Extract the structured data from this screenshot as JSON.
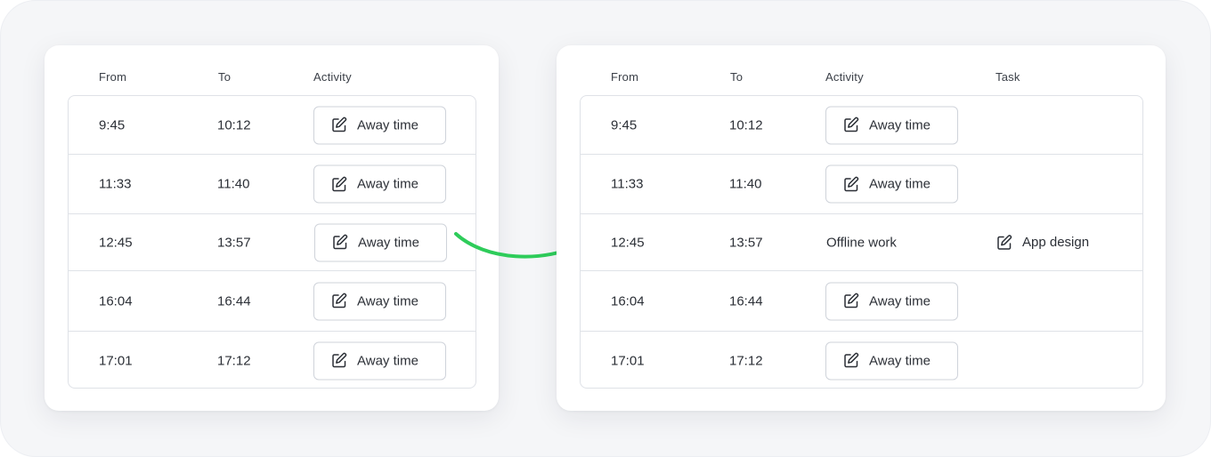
{
  "left_table": {
    "headers": {
      "from": "From",
      "to": "To",
      "activity": "Activity"
    },
    "rows": [
      {
        "from": "9:45",
        "to": "10:12",
        "activity": "Away time"
      },
      {
        "from": "11:33",
        "to": "11:40",
        "activity": "Away time"
      },
      {
        "from": "12:45",
        "to": "13:57",
        "activity": "Away time"
      },
      {
        "from": "16:04",
        "to": "16:44",
        "activity": "Away time"
      },
      {
        "from": "17:01",
        "to": "17:12",
        "activity": "Away time"
      }
    ]
  },
  "right_table": {
    "headers": {
      "from": "From",
      "to": "To",
      "activity": "Activity",
      "task": "Task"
    },
    "rows": [
      {
        "from": "9:45",
        "to": "10:12",
        "activity": "Away time"
      },
      {
        "from": "11:33",
        "to": "11:40",
        "activity": "Away time"
      },
      {
        "from": "12:45",
        "to": "13:57",
        "activity": "Offline work",
        "task": "App design"
      },
      {
        "from": "16:04",
        "to": "16:44",
        "activity": "Away time"
      },
      {
        "from": "17:01",
        "to": "17:12",
        "activity": "Away time"
      }
    ]
  },
  "colors": {
    "arrow": "#2ecc5a",
    "border": "#dfe2e7",
    "text": "#2b2f36"
  },
  "icons": {
    "edit": "edit-icon",
    "arrow": "curved-arrow-icon"
  }
}
